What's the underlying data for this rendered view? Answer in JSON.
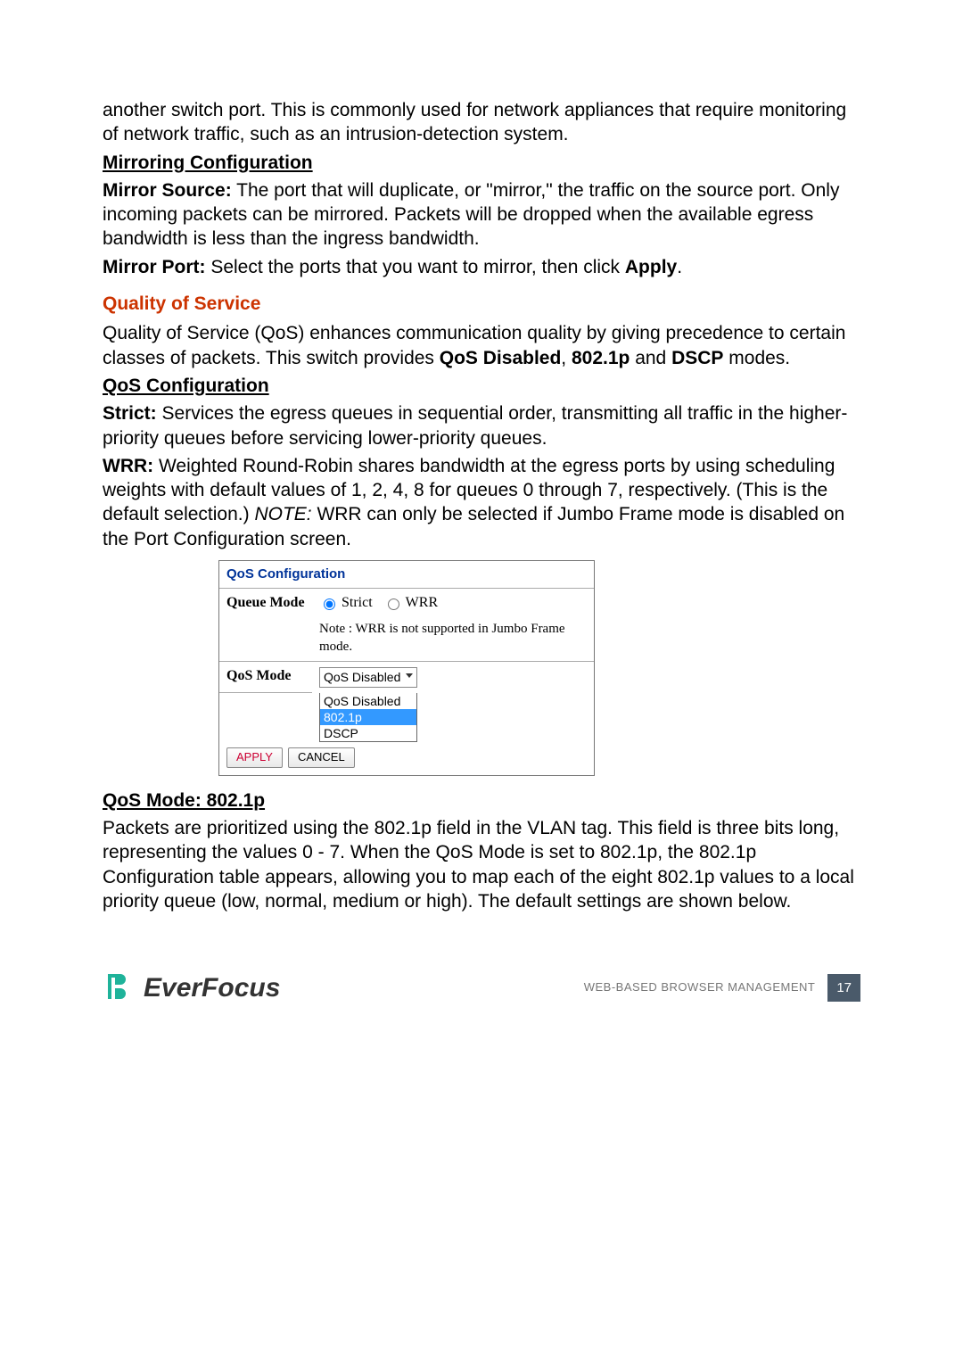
{
  "intro": {
    "line": "another switch port. This is commonly used for network appliances that require monitoring of network traffic, such as an intrusion-detection system."
  },
  "mirroring": {
    "heading": "Mirroring Configuration",
    "source_label": "Mirror Source:",
    "source_text": " The port that will duplicate, or \"mirror,\" the traffic on the source port. Only incoming packets can be mirrored. Packets will be dropped when the available egress bandwidth is less than the ingress bandwidth.",
    "port_label": "Mirror Port:",
    "port_text_a": " Select the ports that you want to mirror, then click ",
    "port_apply": "Apply",
    "port_text_b": "."
  },
  "qos": {
    "title": "Quality of Service",
    "intro_a": "Quality of Service (QoS) enhances communication quality by giving precedence to certain classes of packets. This switch provides ",
    "intro_b": "QoS Disabled",
    "intro_c": ", ",
    "intro_d": "802.1p",
    "intro_e": " and ",
    "intro_f": "DSCP",
    "intro_g": " modes.",
    "config_heading": "QoS Configuration",
    "strict_label": "Strict:",
    "strict_text": " Services the egress queues in sequential order, transmitting all traffic in the higher-priority queues before servicing lower-priority queues.",
    "wrr_label": "WRR:",
    "wrr_text_a": " Weighted Round-Robin shares bandwidth at the egress ports by using scheduling weights with default values of 1, 2, 4, 8 for queues 0 through 7, respectively. (This is the default selection.) ",
    "wrr_note_label": "NOTE:",
    "wrr_text_b": " WRR can only be selected if Jumbo Frame mode is disabled on the Port Configuration screen."
  },
  "panel": {
    "title": "QoS Configuration",
    "queue_mode_label": "Queue Mode",
    "queue_mode_opts": {
      "strict": "Strict",
      "wrr": "WRR"
    },
    "queue_mode_note": "Note : WRR is not supported in Jumbo Frame mode.",
    "qos_mode_label": "QoS Mode",
    "qos_mode_selected": "QoS Disabled",
    "qos_mode_options": [
      "QoS Disabled",
      "802.1p",
      "DSCP"
    ],
    "apply": "APPLY",
    "cancel": "CANCEL"
  },
  "qos_8021p": {
    "heading": "QoS Mode: 802.1p",
    "text": "Packets are prioritized using the 802.1p field in the VLAN tag. This field is three bits long, representing the values 0 - 7. When the QoS Mode is set to 802.1p, the 802.1p Configuration table appears, allowing you to map each of the eight 802.1p values to a local priority queue (low, normal, medium or high). The default settings are shown below."
  },
  "footer": {
    "brand": "EverFocus",
    "label": "WEB-BASED BROWSER MANAGEMENT",
    "page": "17"
  }
}
